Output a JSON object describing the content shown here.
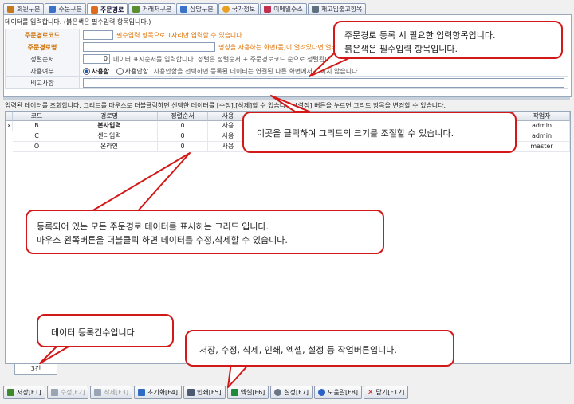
{
  "tabs": [
    {
      "label": "회원구분",
      "color": "#c47a1c",
      "active": false
    },
    {
      "label": "주문구분",
      "color": "#3a72c9",
      "active": false
    },
    {
      "label": "주문경로",
      "color": "#e06a1e",
      "active": true
    },
    {
      "label": "거래처구분",
      "color": "#5a8e2f",
      "active": false
    },
    {
      "label": "상담구분",
      "color": "#3a72c9",
      "active": false
    },
    {
      "label": "국가정보",
      "color": "#e8a020",
      "active": false
    },
    {
      "label": "이메일주소",
      "color": "#c03050",
      "active": false
    },
    {
      "label": "재고입출고항목",
      "color": "#607080",
      "active": false
    }
  ],
  "form": {
    "notice": "데이터를 입력합니다. (붉은색은 필수입력 항목입니다.)",
    "code_label": "주문경로코드",
    "code_hint": "필수입력 항목으로 1자리만 입력할 수 있습니다.",
    "name_label": "주문경로명",
    "name_hint": "명칭을 사용하는 화면(폼)이 열려있다면 열려있는 화면을 모두 닫",
    "order_label": "정렬순서",
    "order_value": "0",
    "order_hint": "데이터 표시순서를 입력합니다. 정렬은 정렬순서 + 주문경로코드 순으로 정렬됩니다.",
    "use_label": "사용여부",
    "use_yes": "사용함",
    "use_no": "사용안함",
    "use_hint": "사용안함을 선택하면 등록된 데이터는 연결된 다른 화면에서 보이지 않습니다.",
    "memo_label": "비고사항"
  },
  "grid": {
    "info": "입력된 데이터를 조회합니다. 그리드를 마우스로 더블클릭하면 선택한 데이터를 [수정],[삭제]할 수 있습니다. [설정] 버튼을 누르면 그리드 항목을 변경할 수 있습니다.",
    "columns": [
      "코드",
      "경로명",
      "정렬순서",
      "사용",
      "작업자"
    ],
    "rows": [
      {
        "code": "B",
        "name": "본사입력",
        "order": "0",
        "use": "사용",
        "worker": "admin"
      },
      {
        "code": "C",
        "name": "센터입력",
        "order": "0",
        "use": "사용",
        "worker": "admin"
      },
      {
        "code": "O",
        "name": "온라인",
        "order": "0",
        "use": "사용",
        "worker": "master"
      }
    ],
    "count": "3건"
  },
  "toolbar": [
    {
      "label": "저장[F1]",
      "icon": "save-icon",
      "color": "#3c8a2c",
      "disabled": false
    },
    {
      "label": "수정[F2]",
      "icon": "edit-icon",
      "color": "#9aa4b2",
      "disabled": true
    },
    {
      "label": "삭제[F3]",
      "icon": "delete-icon",
      "color": "#9aa4b2",
      "disabled": true
    },
    {
      "label": "초기화[F4]",
      "icon": "reset-icon",
      "color": "#2f6bc2",
      "disabled": false
    },
    {
      "label": "인쇄[F5]",
      "icon": "print-icon",
      "color": "#4a5a70",
      "disabled": false
    },
    {
      "label": "엑셀[F6]",
      "icon": "excel-icon",
      "color": "#1f8a3a",
      "disabled": false
    },
    {
      "label": "설정[F7]",
      "icon": "gear-icon",
      "color": "#6a7484",
      "disabled": false
    },
    {
      "label": "도움말[F8]",
      "icon": "help-icon",
      "color": "#2a62c8",
      "disabled": false
    },
    {
      "label": "닫기[F12]",
      "icon": "close-icon",
      "color": "#d02020",
      "disabled": false
    }
  ],
  "callouts": {
    "input_1": "주문경로 등록 시 필요한 입력항목입니다.",
    "input_2": "붉은색은 필수입력 항목입니다.",
    "resize": "이곳을 클릭하여 그리드의 크기를 조절할 수 있습니다.",
    "grid_1": "등록되어 있는 모든 주문경로 데이터를 표시하는 그리드 입니다.",
    "grid_2": "마우스 왼쪽버튼을 더블클릭 하면 데이터를 수정,삭제할 수 있습니다.",
    "count": "데이터 등록건수입니다.",
    "buttons": "저장, 수정, 삭제, 인쇄, 엑셀, 설정 등 작업버튼입니다."
  }
}
